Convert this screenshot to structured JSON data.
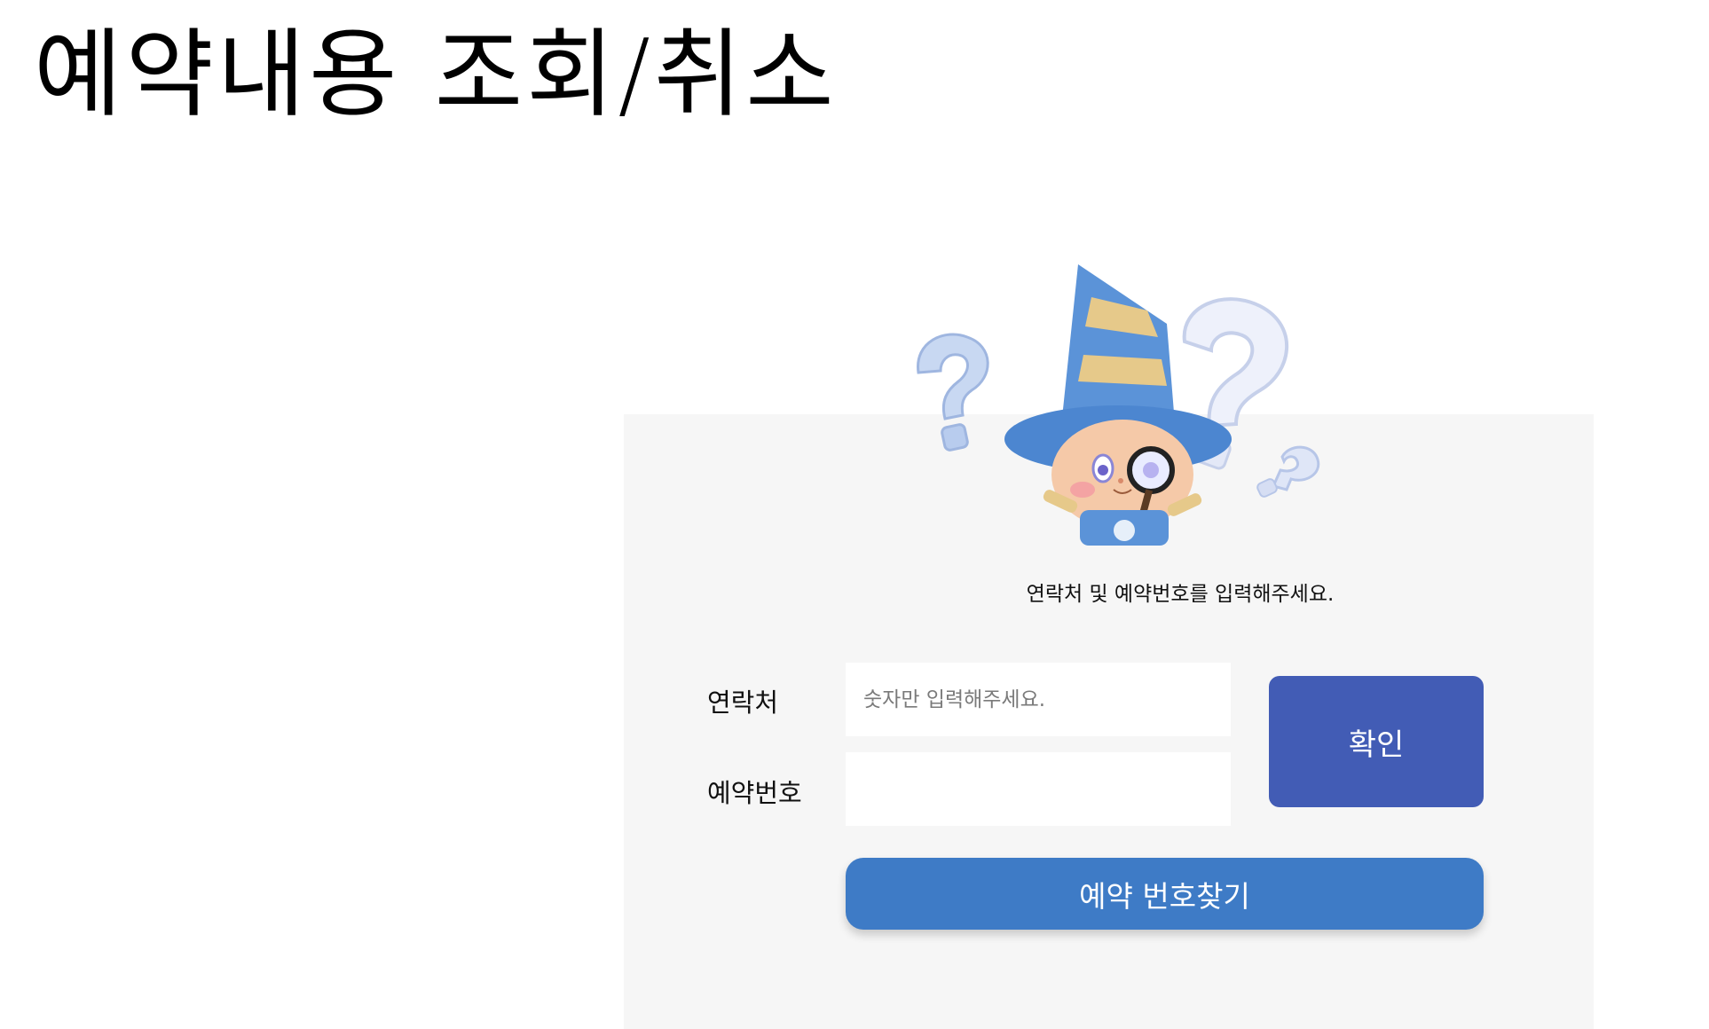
{
  "page": {
    "title": "예약내용 조회/취소"
  },
  "form": {
    "instruction": "연락처 및 예약번호를 입력해주세요.",
    "contact_label": "연락처",
    "contact_placeholder": "숫자만 입력해주세요.",
    "contact_value": "",
    "reservation_label": "예약번호",
    "reservation_placeholder": "",
    "reservation_value": "",
    "confirm_label": "확인",
    "find_reservation_label": "예약 번호찾기"
  },
  "mascot": {
    "icon": "wizard-with-magnifier-and-question-marks"
  },
  "colors": {
    "panel_bg": "#f6f6f6",
    "confirm_button": "#425cb5",
    "find_button": "#3e7bc6"
  }
}
